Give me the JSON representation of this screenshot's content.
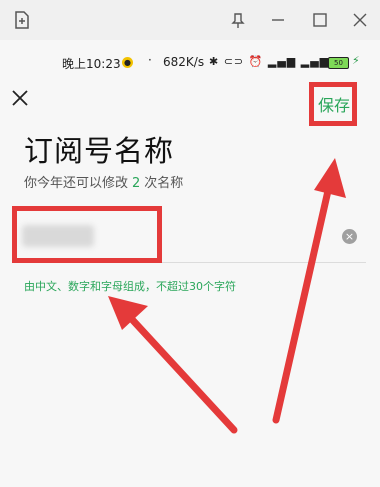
{
  "statusbar": {
    "time": "晚上10:23",
    "dot": "·",
    "speed": "682K/s",
    "battery": "50"
  },
  "header": {
    "save_label": "保存"
  },
  "form": {
    "title": "订阅号名称",
    "subtitle_prefix": "你今年还可以修改",
    "remaining": "2",
    "subtitle_suffix": "次名称",
    "hint": "由中文、数字和字母组成，不超过30个字符"
  },
  "colors": {
    "accent": "#2aa65a",
    "annotation": "#e43a3a"
  }
}
